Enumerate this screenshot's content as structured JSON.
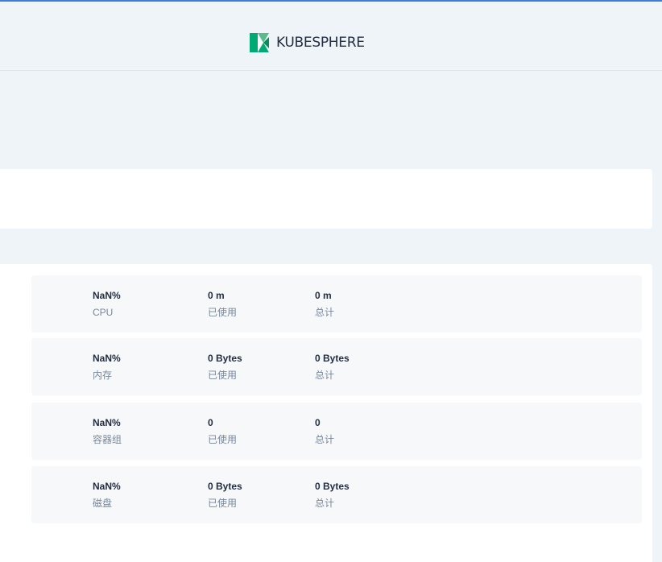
{
  "header": {
    "logo_text": "KUBESPHERE",
    "logo_icon": "kubesphere-logo-icon",
    "accent_color": "#3d7fd8",
    "brand_color": "#00aa72"
  },
  "resources": [
    {
      "name": "cpu",
      "percent": "NaN%",
      "label": "CPU",
      "used": "0 m",
      "used_label": "已使用",
      "total": "0 m",
      "total_label": "总计"
    },
    {
      "name": "memory",
      "percent": "NaN%",
      "label": "内存",
      "used": "0 Bytes",
      "used_label": "已使用",
      "total": "0 Bytes",
      "total_label": "总计"
    },
    {
      "name": "pods",
      "percent": "NaN%",
      "label": "容器组",
      "used": "0",
      "used_label": "已使用",
      "total": "0",
      "total_label": "总计"
    },
    {
      "name": "disk",
      "percent": "NaN%",
      "label": "磁盘",
      "used": "0 Bytes",
      "used_label": "已使用",
      "total": "0 Bytes",
      "total_label": "总计"
    }
  ]
}
